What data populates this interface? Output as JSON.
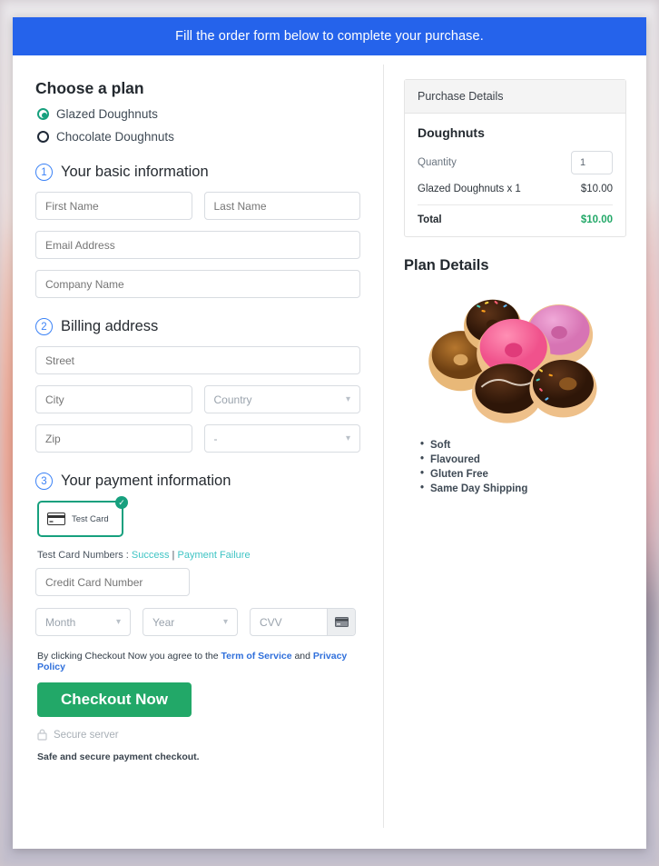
{
  "banner": {
    "text": "Fill the order form below to complete your purchase."
  },
  "plan": {
    "heading": "Choose a plan",
    "options": [
      {
        "label": "Glazed Doughnuts",
        "selected": true
      },
      {
        "label": "Chocolate Doughnuts",
        "selected": false
      }
    ]
  },
  "step1": {
    "number": "1",
    "title": "Your basic information",
    "first_name_placeholder": "First Name",
    "last_name_placeholder": "Last Name",
    "email_placeholder": "Email Address",
    "company_placeholder": "Company Name"
  },
  "step2": {
    "number": "2",
    "title": "Billing address",
    "street_placeholder": "Street",
    "city_placeholder": "City",
    "country_placeholder": "Country",
    "zip_placeholder": "Zip",
    "state_placeholder": "-"
  },
  "step3": {
    "number": "3",
    "title": "Your payment information",
    "card_method_label": "Test Card",
    "card_method_icon": "credit-card-icon",
    "selected_check_icon": "check-circle-icon",
    "test_numbers_prefix": "Test Card Numbers : ",
    "test_numbers_success": "Success",
    "test_numbers_separator": " | ",
    "test_numbers_failure": "Payment Failure",
    "credit_card_placeholder": "Credit Card Number",
    "month_placeholder": "Month",
    "year_placeholder": "Year",
    "cvv_placeholder": "CVV",
    "cvv_icon": "credit-card-icon"
  },
  "footer": {
    "agree_prefix": "By clicking Checkout Now you agree to the ",
    "terms_link": "Term of Service",
    "agree_mid": " and ",
    "privacy_link": "Privacy Policy",
    "checkout_label": "Checkout Now",
    "secure_icon": "lock-icon",
    "secure_label": "Secure server",
    "safe_text": "Safe and secure payment checkout."
  },
  "purchase": {
    "header": "Purchase Details",
    "product": "Doughnuts",
    "quantity_label": "Quantity",
    "quantity_value": "1",
    "line_item_label": "Glazed Doughnuts x 1",
    "line_item_price": "$10.00",
    "total_label": "Total",
    "total_price": "$10.00"
  },
  "plan_details": {
    "heading": "Plan Details",
    "image_name": "doughnuts-photo",
    "features": [
      "Soft",
      "Flavoured",
      "Gluten Free",
      "Same Day Shipping"
    ]
  },
  "colors": {
    "banner_blue": "#2563eb",
    "accent_green": "#22a868",
    "radio_green": "#17a07e",
    "link_teal": "#3fc4c4",
    "link_blue": "#2f6fdb",
    "step_number_blue": "#3b82f6"
  }
}
